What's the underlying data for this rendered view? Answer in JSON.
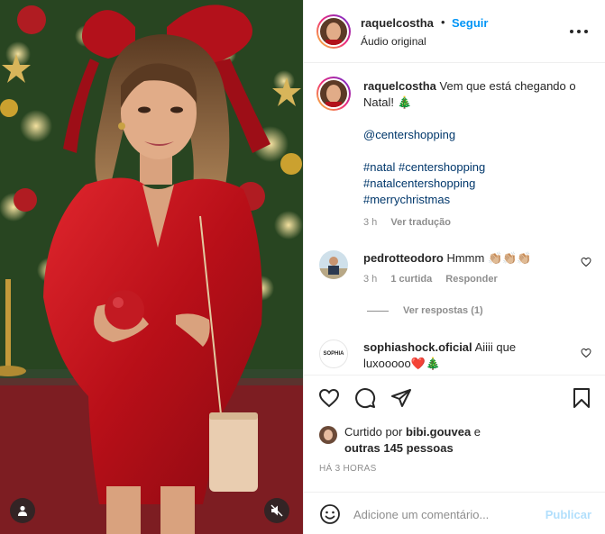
{
  "post": {
    "author": "raquelcostha",
    "follow_label": "Seguir",
    "audio_label": "Áudio original"
  },
  "caption": {
    "username": "raquelcostha",
    "text": "Vem que está chegando o Natal! 🎄",
    "mention": "@centershopping",
    "hashtags": [
      "#natal",
      "#centershopping",
      "#natalcentershopping",
      "#merrychristmas"
    ],
    "time": "3 h",
    "translate_label": "Ver tradução"
  },
  "comments": [
    {
      "username": "pedrotteodoro",
      "text": "Hmmm 👏🏼👏🏼👏🏼",
      "time": "3 h",
      "likes": "1 curtida",
      "reply_label": "Responder",
      "view_replies": "Ver respostas (1)"
    },
    {
      "username": "sophiashock.oficial",
      "text": "Aiiii que luxooooo❤️🎄",
      "avatar_text": "SOPHIA"
    }
  ],
  "likes": {
    "prefix": "Curtido por",
    "user": "bibi.gouvea",
    "connector": "e",
    "others": "outras 145 pessoas"
  },
  "timestamp": "HÁ 3 HORAS",
  "composer": {
    "placeholder": "Adicione um comentário...",
    "publish_label": "Publicar"
  },
  "colors": {
    "accent": "#0095f6",
    "publish_disabled": "#b2dffc",
    "dress": "#c8161f"
  }
}
